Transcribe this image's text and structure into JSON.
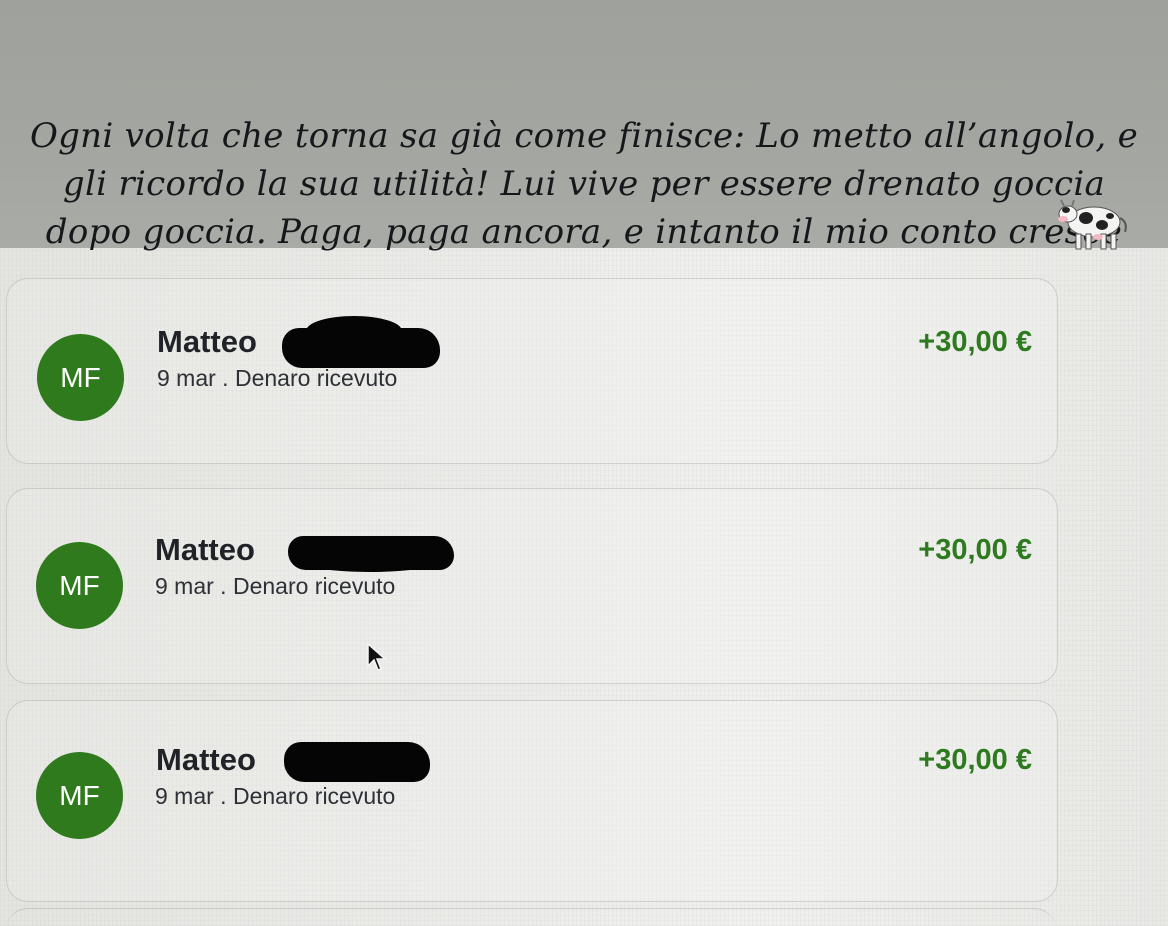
{
  "story": {
    "caption": "Ogni volta che torna sa già come finisce: Lo metto all’angolo, e gli ricordo la sua utilità! Lui vive per essere drenato goccia dopo goccia. Paga, paga ancora, e intanto il mio conto cresce",
    "sticker_icon": "cow-icon"
  },
  "transactions": [
    {
      "avatar_initials": "MF",
      "name": "Matteo",
      "subtitle": "9 mar . Denaro ricevuto",
      "amount": "+30,00 €"
    },
    {
      "avatar_initials": "MF",
      "name": "Matteo",
      "subtitle": "9 mar . Denaro ricevuto",
      "amount": "+30,00 €"
    },
    {
      "avatar_initials": "MF",
      "name": "Matteo",
      "subtitle": "9 mar . Denaro ricevuto",
      "amount": "+30,00 €"
    }
  ],
  "colors": {
    "avatar_green": "#2e7a1c",
    "amount_green": "#2d7a1f",
    "redaction": "#050505"
  },
  "icons": [
    "cow-icon",
    "mouse-pointer-icon"
  ]
}
